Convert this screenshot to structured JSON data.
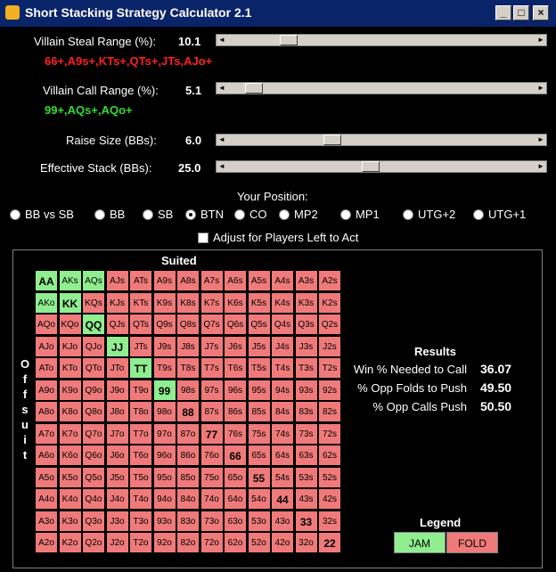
{
  "window": {
    "title": "Short Stacking Strategy Calculator 2.1",
    "min_glyph": "_",
    "max_glyph": "□",
    "close_glyph": "×"
  },
  "sliders": {
    "steal": {
      "label": "Villain Steal Range (%):",
      "value": "10.1",
      "range": "66+,A9s+,KTs+,QTs+,JTs,AJo+",
      "level": 0.18
    },
    "call": {
      "label": "Villain Call Range (%):",
      "value": "5.1",
      "range": "99+,AQs+,AQo+",
      "level": 0.06
    },
    "raise": {
      "label": "Raise Size (BBs):",
      "value": "6.0",
      "level": 0.33
    },
    "stack": {
      "label": "Effective Stack (BBs):",
      "value": "25.0",
      "level": 0.46
    },
    "left_arrow": "◄",
    "right_arrow": "►"
  },
  "position": {
    "title": "Your Position:",
    "options": [
      "BB vs SB",
      "BB",
      "SB",
      "BTN",
      "CO",
      "MP2",
      "MP1",
      "UTG+2",
      "UTG+1"
    ],
    "selected": "BTN"
  },
  "adjust_checkbox": {
    "label": "Adjust for Players Left to Act",
    "checked": false
  },
  "matrix": {
    "suited_label": "Suited",
    "offsuit_label": [
      "O",
      "f",
      "f",
      "s",
      "u",
      "i",
      "t"
    ],
    "ranks": [
      "A",
      "K",
      "Q",
      "J",
      "T",
      "9",
      "8",
      "7",
      "6",
      "5",
      "4",
      "3",
      "2"
    ],
    "jam": [
      "AA",
      "AKs",
      "AQs",
      "AKo",
      "KK",
      "QQ",
      "JJ",
      "TT",
      "99"
    ]
  },
  "results": {
    "title": "Results",
    "rows": [
      {
        "label": "Win % Needed to Call",
        "value": "36.07"
      },
      {
        "label": "% Opp Folds to Push",
        "value": "49.50"
      },
      {
        "label": "% Opp Calls Push",
        "value": "50.50"
      }
    ]
  },
  "legend": {
    "title": "Legend",
    "jam": "JAM",
    "fold": "FOLD",
    "jam_color": "#90ee90",
    "fold_color": "#f07a7a"
  }
}
